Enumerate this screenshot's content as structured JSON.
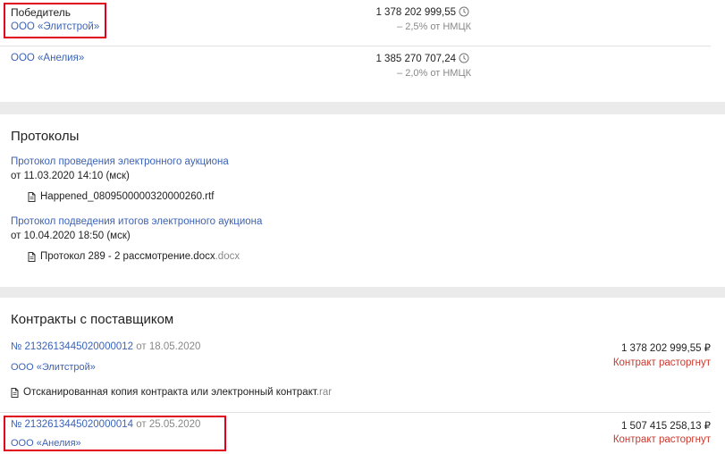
{
  "bids": {
    "winner_label": "Победитель",
    "winner_company": "ООО «Элитстрой»",
    "winner_amount": "1 378 202 999,55",
    "winner_delta": "– 2,5% от НМЦК",
    "second_company": "ООО «Анелия»",
    "second_amount": "1 385 270 707,24",
    "second_delta": "– 2,0% от НМЦК"
  },
  "protocols": {
    "title": "Протоколы",
    "items": [
      {
        "name": "Протокол проведения электронного аукциона",
        "date": "от 11.03.2020 14:10 (мск)",
        "file_name": "Happened_0809500000320000260.rtf",
        "file_ext": ".rtf"
      },
      {
        "name": "Протокол подведения итогов электронного аукциона",
        "date": "от 10.04.2020 18:50 (мск)",
        "file_name": "Протокол 289 - 2 рассмотрение.docx",
        "file_ext": ".docx"
      }
    ]
  },
  "contracts": {
    "title": "Контракты с поставщиком",
    "items": [
      {
        "number": "№ 2132613445020000012",
        "date": "от 18.05.2020",
        "company": "ООО «Элитстрой»",
        "amount": "1 378 202 999,55 ₽",
        "status": "Контракт расторгнут",
        "file_name": "Отсканированная копия контракта или электронный контракт",
        "file_ext": ".rar"
      },
      {
        "number": "№ 2132613445020000014",
        "date": "от 25.05.2020",
        "company": "ООО «Анелия»",
        "amount": "1 507 415 258,13 ₽",
        "status": "Контракт расторгнут"
      }
    ]
  },
  "colors": {
    "link": "#3b63b7",
    "status": "#c9392e",
    "highlight": "#e0001b",
    "section_gap": "#ebebeb"
  }
}
